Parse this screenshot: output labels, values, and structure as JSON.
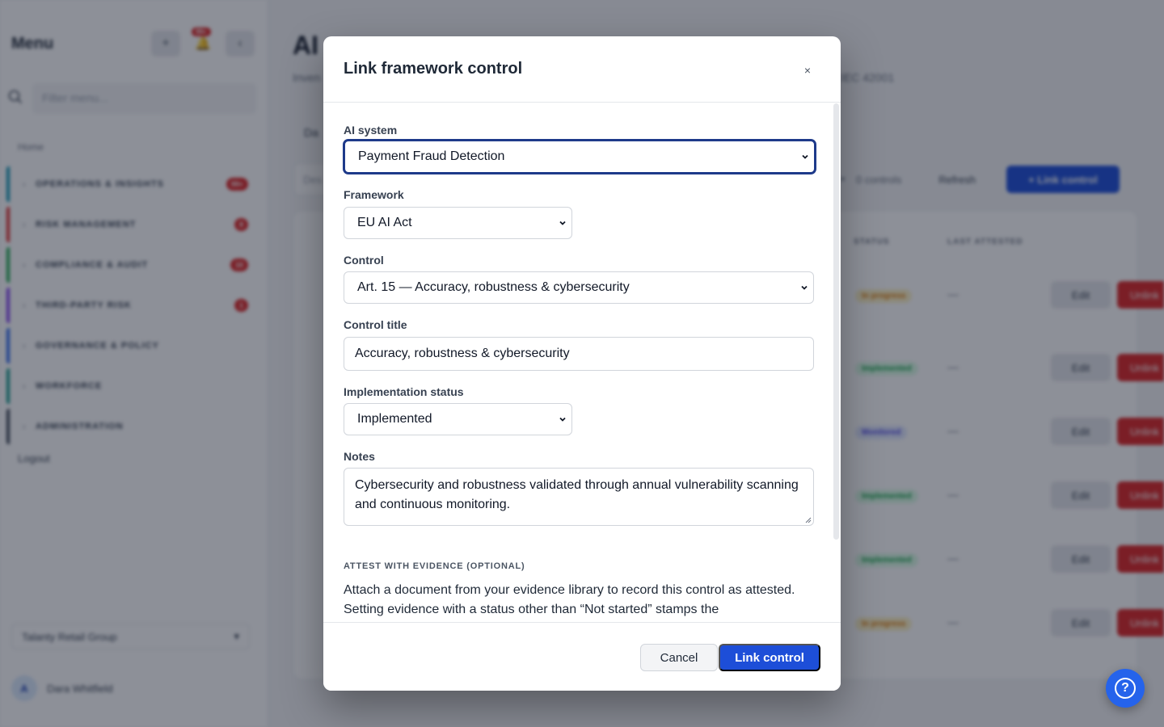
{
  "background": {
    "sidebar": {
      "title": "Menu",
      "add_icon": "plus-icon",
      "notification_badge": "99+",
      "collapse_icon": "chevron-left-icon",
      "filter_placeholder": "Filter menu...",
      "home_label": "Home",
      "sections": [
        {
          "label": "OPERATIONS & INSIGHTS",
          "count": "99+",
          "color": "#0891b2"
        },
        {
          "label": "RISK MANAGEMENT",
          "count": "8",
          "color": "#dc2626"
        },
        {
          "label": "COMPLIANCE & AUDIT",
          "count": "10",
          "color": "#16a34a"
        },
        {
          "label": "THIRD-PARTY RISK",
          "count": "1",
          "color": "#7c3aed"
        },
        {
          "label": "GOVERNANCE & POLICY",
          "count": "",
          "color": "#2563eb"
        },
        {
          "label": "WORKFORCE",
          "count": "",
          "color": "#0d9488"
        },
        {
          "label": "ADMINISTRATION",
          "count": "",
          "color": "#374151"
        }
      ],
      "logout_label": "Logout",
      "organization": "Talanty Retail Group",
      "user_initial": "A",
      "user_name": "Dara Whitfield"
    },
    "main": {
      "title": "AI",
      "subtitle_left": "Inven",
      "subtitle_right": "IEC 42001",
      "tab_label": "Da",
      "filter_placeholder": "Des",
      "controls_count": "0 controls",
      "refresh_label": "Refresh",
      "link_control_label": "+ Link control",
      "columns": [
        "STATUS",
        "LAST ATTESTED"
      ],
      "rows": [
        {
          "status": "In progress",
          "status_color": "#d97706",
          "attested": "—",
          "edit": "Edit",
          "unlink": "Unlink"
        },
        {
          "status": "Implemented",
          "status_color": "#16a34a",
          "attested": "—",
          "edit": "Edit",
          "unlink": "Unlink"
        },
        {
          "status": "Monitored",
          "status_color": "#4f46e5",
          "attested": "—",
          "edit": "Edit",
          "unlink": "Unlink"
        },
        {
          "status": "Implemented",
          "status_color": "#16a34a",
          "attested": "—",
          "edit": "Edit",
          "unlink": "Unlink"
        },
        {
          "status": "Implemented",
          "status_color": "#16a34a",
          "attested": "—",
          "edit": "Edit",
          "unlink": "Unlink"
        },
        {
          "status": "In progress",
          "status_color": "#d97706",
          "attested": "—",
          "edit": "Edit",
          "unlink": "Unlink"
        }
      ]
    },
    "help_icon": "help-circle-icon"
  },
  "modal": {
    "title": "Link framework control",
    "close_glyph": "×",
    "fields": {
      "ai_system": {
        "label": "AI system",
        "value": "Payment Fraud Detection"
      },
      "framework": {
        "label": "Framework",
        "value": "EU AI Act"
      },
      "control": {
        "label": "Control",
        "value": "Art. 15 — Accuracy, robustness & cybersecurity"
      },
      "control_title": {
        "label": "Control title",
        "value": "Accuracy, robustness & cybersecurity"
      },
      "implementation_status": {
        "label": "Implementation status",
        "value": "Implemented"
      },
      "notes": {
        "label": "Notes",
        "value": "Cybersecurity and robustness validated through annual vulnerability scanning and continuous monitoring."
      }
    },
    "evidence": {
      "heading": "ATTEST WITH EVIDENCE (OPTIONAL)",
      "help_text": "Attach a document from your evidence library to record this control as attested. Setting evidence with a status other than “Not started” stamps the"
    },
    "footer": {
      "cancel_label": "Cancel",
      "submit_label": "Link control"
    },
    "colors": {
      "primary": "#1d4ed8",
      "focus_ring": "#1e3a8a"
    }
  }
}
